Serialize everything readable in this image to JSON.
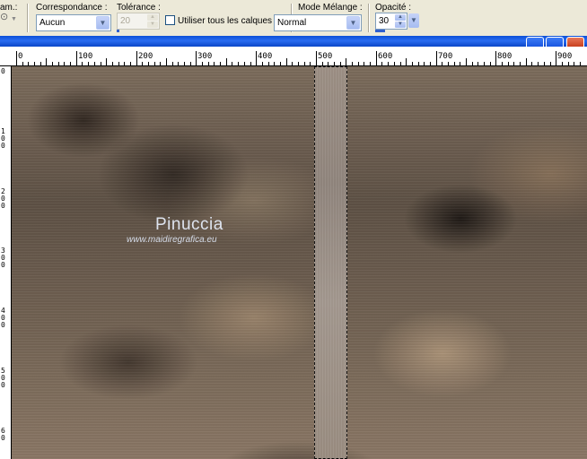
{
  "toolbar": {
    "partial_label": "am.:",
    "match_mode_label": "Correspondance :",
    "match_mode_value": "Aucun",
    "tolerance_label": "Tolérance :",
    "tolerance_value": "20",
    "use_all_layers_label": "Utiliser tous les calques",
    "blend_mode_label": "Mode Mélange :",
    "blend_mode_value": "Normal",
    "opacity_label": "Opacité :",
    "opacity_value": "30"
  },
  "ruler": {
    "h_labels": [
      "0",
      "100",
      "200",
      "300",
      "400",
      "500",
      "600",
      "700",
      "800",
      "900"
    ],
    "v_labels": [
      "0",
      "1\n0\n0",
      "2\n0\n0",
      "3\n0\n0",
      "4\n0\n0",
      "5\n0\n0",
      "6\n0"
    ]
  },
  "watermark": {
    "name": "Pinuccia",
    "url": "www.maidiregrafica.eu"
  }
}
